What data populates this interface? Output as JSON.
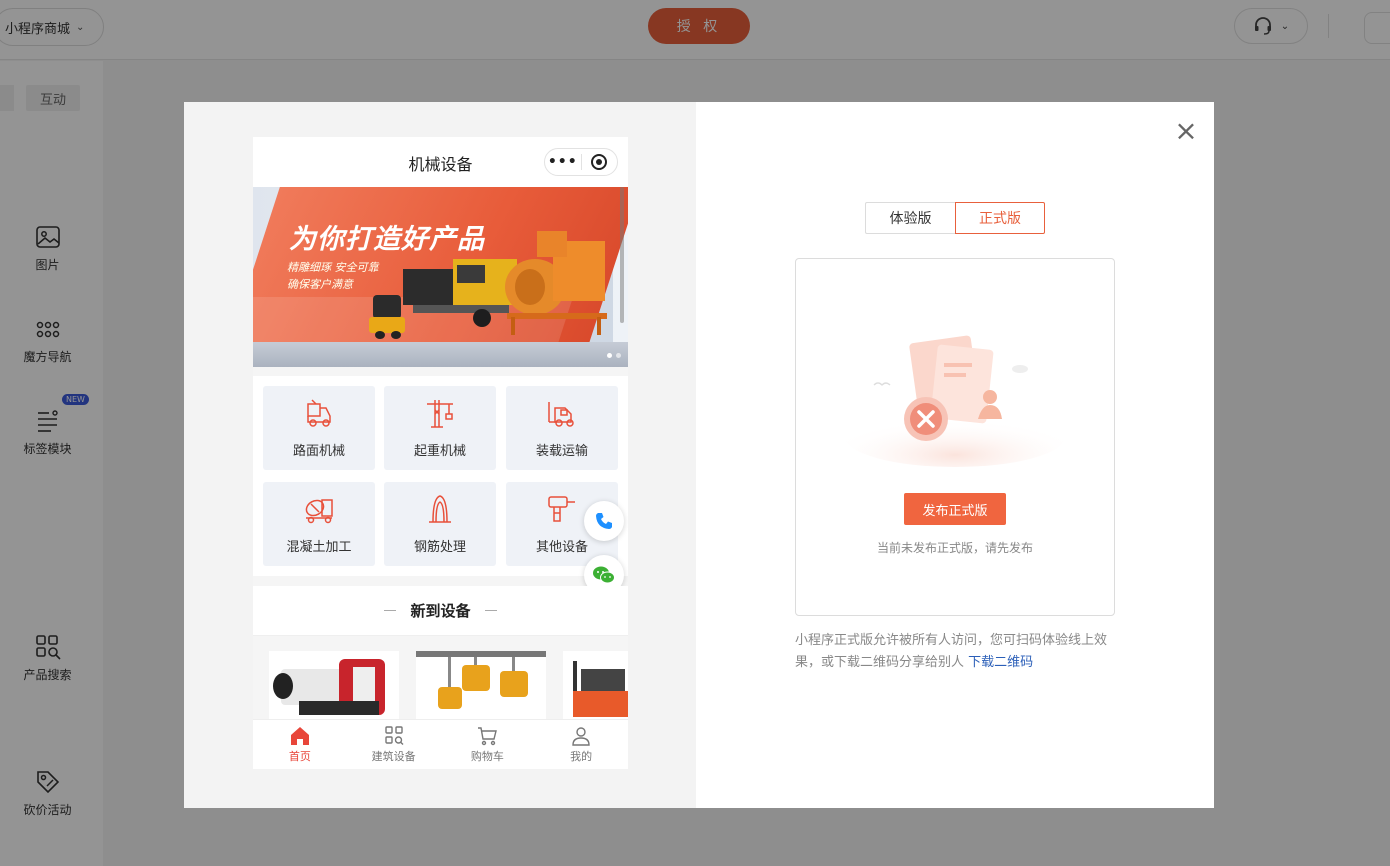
{
  "topbar": {
    "store_name": "小程序商城",
    "auth_label": "授 权"
  },
  "sidebar": {
    "tab_label": "互动",
    "items": [
      {
        "label": "图片",
        "icon": "image-icon"
      },
      {
        "label": "魔方导航",
        "icon": "grid-dots-icon"
      },
      {
        "label": "标签模块",
        "icon": "list-icon",
        "badge": "NEW"
      },
      {
        "label": "产品搜索",
        "icon": "search-grid-icon"
      },
      {
        "label": "砍价活动",
        "icon": "tag-icon"
      }
    ]
  },
  "preview": {
    "nav_title": "机械设备",
    "capsule_dots": "•••",
    "banner": {
      "slogan": "为你打造好产品",
      "sub_line1": "精雕细琢 安全可靠",
      "sub_line2": "确保客户满意"
    },
    "categories": [
      {
        "label": "路面机械",
        "icon": "road-machine-icon"
      },
      {
        "label": "起重机械",
        "icon": "crane-icon"
      },
      {
        "label": "装载运输",
        "icon": "forklift-icon"
      },
      {
        "label": "混凝土加工",
        "icon": "concrete-mixer-icon"
      },
      {
        "label": "钢筋处理",
        "icon": "rebar-icon"
      },
      {
        "label": "其他设备",
        "icon": "drill-icon"
      }
    ],
    "section_title": "新到设备",
    "tabbar": [
      {
        "label": "首页",
        "icon": "home-icon",
        "active": true
      },
      {
        "label": "建筑设备",
        "icon": "grid-search-icon",
        "active": false
      },
      {
        "label": "购物车",
        "icon": "cart-icon",
        "active": false
      },
      {
        "label": "我的",
        "icon": "user-icon",
        "active": false
      }
    ]
  },
  "version": {
    "tabs": [
      {
        "label": "体验版",
        "active": false
      },
      {
        "label": "正式版",
        "active": true
      }
    ],
    "publish_label": "发布正式版",
    "empty_tip": "当前未发布正式版，请先发布",
    "desc_text": "小程序正式版允许被所有人访问，您可扫码体验线上效果，或下载二维码分享给别人",
    "download_link": "下载二维码"
  },
  "colors": {
    "accent": "#e8603c",
    "active_tab": "#e8463a",
    "link": "#2b5fb8"
  }
}
